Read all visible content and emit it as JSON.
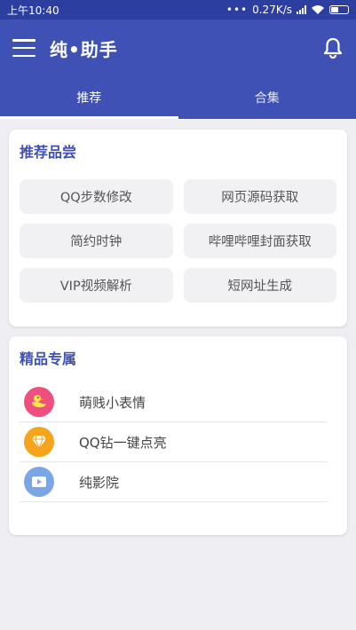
{
  "status_bar": {
    "time": "上午10:40",
    "net_speed": "0.27K/s"
  },
  "app_bar": {
    "title": "纯•助手"
  },
  "tabs": [
    {
      "label": "推荐"
    },
    {
      "label": "合集"
    }
  ],
  "recommend": {
    "title": "推荐品尝",
    "items": [
      {
        "label": "QQ步数修改"
      },
      {
        "label": "网页源码获取"
      },
      {
        "label": "简约时钟"
      },
      {
        "label": "哔哩哔哩封面获取"
      },
      {
        "label": "VIP视频解析"
      },
      {
        "label": "短网址生成"
      }
    ]
  },
  "premium": {
    "title": "精品专属",
    "items": [
      {
        "label": "萌贱小表情",
        "icon": "duck-icon",
        "color": "#ef4f7f"
      },
      {
        "label": "QQ钻一键点亮",
        "icon": "diamond-icon",
        "color": "#f5a41b"
      },
      {
        "label": "纯影院",
        "icon": "video-play-icon",
        "color": "#7aa6e6"
      }
    ]
  },
  "colors": {
    "primary": "#3f51b5",
    "status_bar": "#2c3fa0",
    "background": "#efeff3"
  }
}
